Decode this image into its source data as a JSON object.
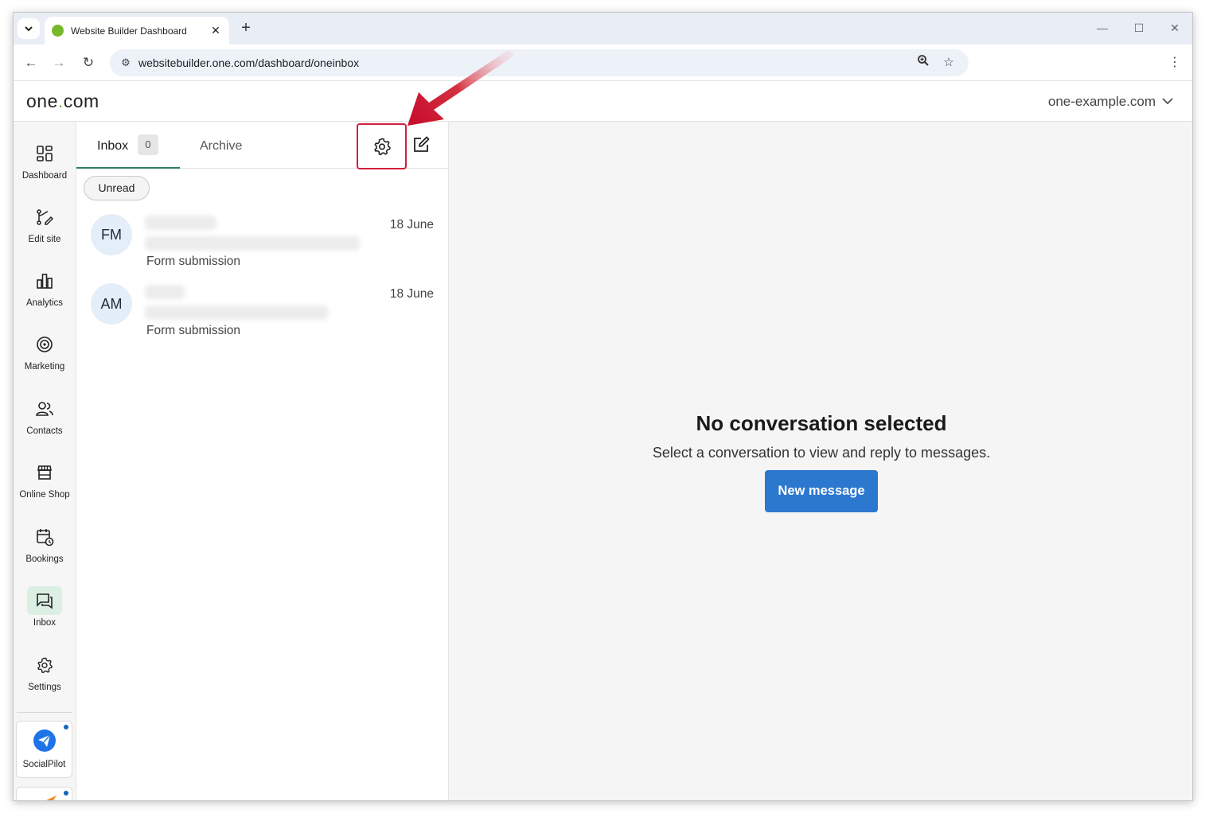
{
  "browser": {
    "tab_title": "Website Builder Dashboard",
    "url": "websitebuilder.one.com/dashboard/oneinbox"
  },
  "header": {
    "logo_prefix": "one",
    "logo_dot": ".",
    "logo_suffix": "com",
    "domain": "one-example.com"
  },
  "sidebar": {
    "items": [
      {
        "label": "Dashboard",
        "icon": "dashboard-icon"
      },
      {
        "label": "Edit site",
        "icon": "edit-site-icon"
      },
      {
        "label": "Analytics",
        "icon": "analytics-icon"
      },
      {
        "label": "Marketing",
        "icon": "marketing-icon"
      },
      {
        "label": "Contacts",
        "icon": "contacts-icon"
      },
      {
        "label": "Online Shop",
        "icon": "shop-icon"
      },
      {
        "label": "Bookings",
        "icon": "bookings-icon"
      },
      {
        "label": "Inbox",
        "icon": "inbox-icon",
        "active": true
      },
      {
        "label": "Settings",
        "icon": "settings-icon"
      }
    ],
    "apps": [
      {
        "label": "SocialPilot",
        "icon": "socialpilot-icon"
      }
    ]
  },
  "inbox": {
    "tab_inbox": "Inbox",
    "inbox_count": "0",
    "tab_archive": "Archive",
    "filter_unread": "Unread",
    "conversations": [
      {
        "initials": "FM",
        "subject": "Form submission",
        "date": "18 June"
      },
      {
        "initials": "AM",
        "subject": "Form submission",
        "date": "18 June"
      }
    ]
  },
  "detail": {
    "title": "No conversation selected",
    "text": "Select a conversation to view and reply to messages.",
    "button": "New message"
  },
  "colors": {
    "accent_green": "#76b82a",
    "primary_blue": "#2c78cf",
    "highlight_red": "#d21f3c"
  }
}
